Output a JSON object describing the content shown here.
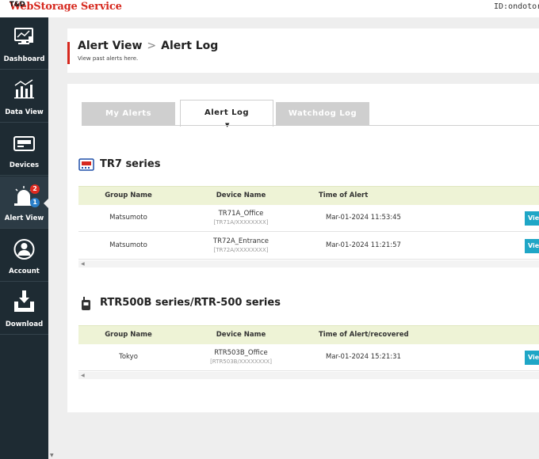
{
  "header": {
    "brand_prefix": "T&D",
    "brand_name": "WebStorage Service",
    "user_id": "ID:ondotori"
  },
  "sidebar": {
    "items": [
      {
        "label": "Dashboard",
        "icon": "dashboard-icon"
      },
      {
        "label": "Data View",
        "icon": "chart-icon"
      },
      {
        "label": "Devices",
        "icon": "device-icon"
      },
      {
        "label": "Alert View",
        "icon": "alarm-icon",
        "active": true,
        "badge_red": "2",
        "badge_blue": "1"
      },
      {
        "label": "Account",
        "icon": "user-icon"
      },
      {
        "label": "Download",
        "icon": "download-icon"
      }
    ]
  },
  "page": {
    "breadcrumb_parent": "Alert View",
    "breadcrumb_current": "Alert Log",
    "subtitle": "View past alerts here."
  },
  "tabs": [
    {
      "label": "My Alerts",
      "active": false
    },
    {
      "label": "Alert Log",
      "active": true
    },
    {
      "label": "Watchdog Log",
      "active": false
    }
  ],
  "sections": [
    {
      "title": "TR7 series",
      "columns": [
        "Group Name",
        "Device Name",
        "Time of Alert"
      ],
      "rows": [
        {
          "group": "Matsumoto",
          "device": "TR71A_Office",
          "serial": "[TR71A/XXXXXXXX]",
          "time": "Mar-01-2024 11:53:45",
          "action": "View"
        },
        {
          "group": "Matsumoto",
          "device": "TR72A_Entrance",
          "serial": "[TR72A/XXXXXXXX]",
          "time": "Mar-01-2024 11:21:57",
          "action": "View"
        }
      ]
    },
    {
      "title": "RTR500B series/RTR-500 series",
      "columns": [
        "Group Name",
        "Device Name",
        "Time of Alert/recovered"
      ],
      "rows": [
        {
          "group": "Tokyo",
          "device": "RTR503B_Office",
          "serial": "[RTR503B/XXXXXXXX]",
          "time": "Mar-01-2024 15:21:31",
          "action": "View"
        }
      ]
    }
  ],
  "colors": {
    "brand_red": "#d6281e",
    "sidebar_bg": "#1e2b33",
    "table_header_bg": "#eef3d6",
    "view_button": "#1fa6c6",
    "tab_inactive": "#cfcfcf"
  }
}
